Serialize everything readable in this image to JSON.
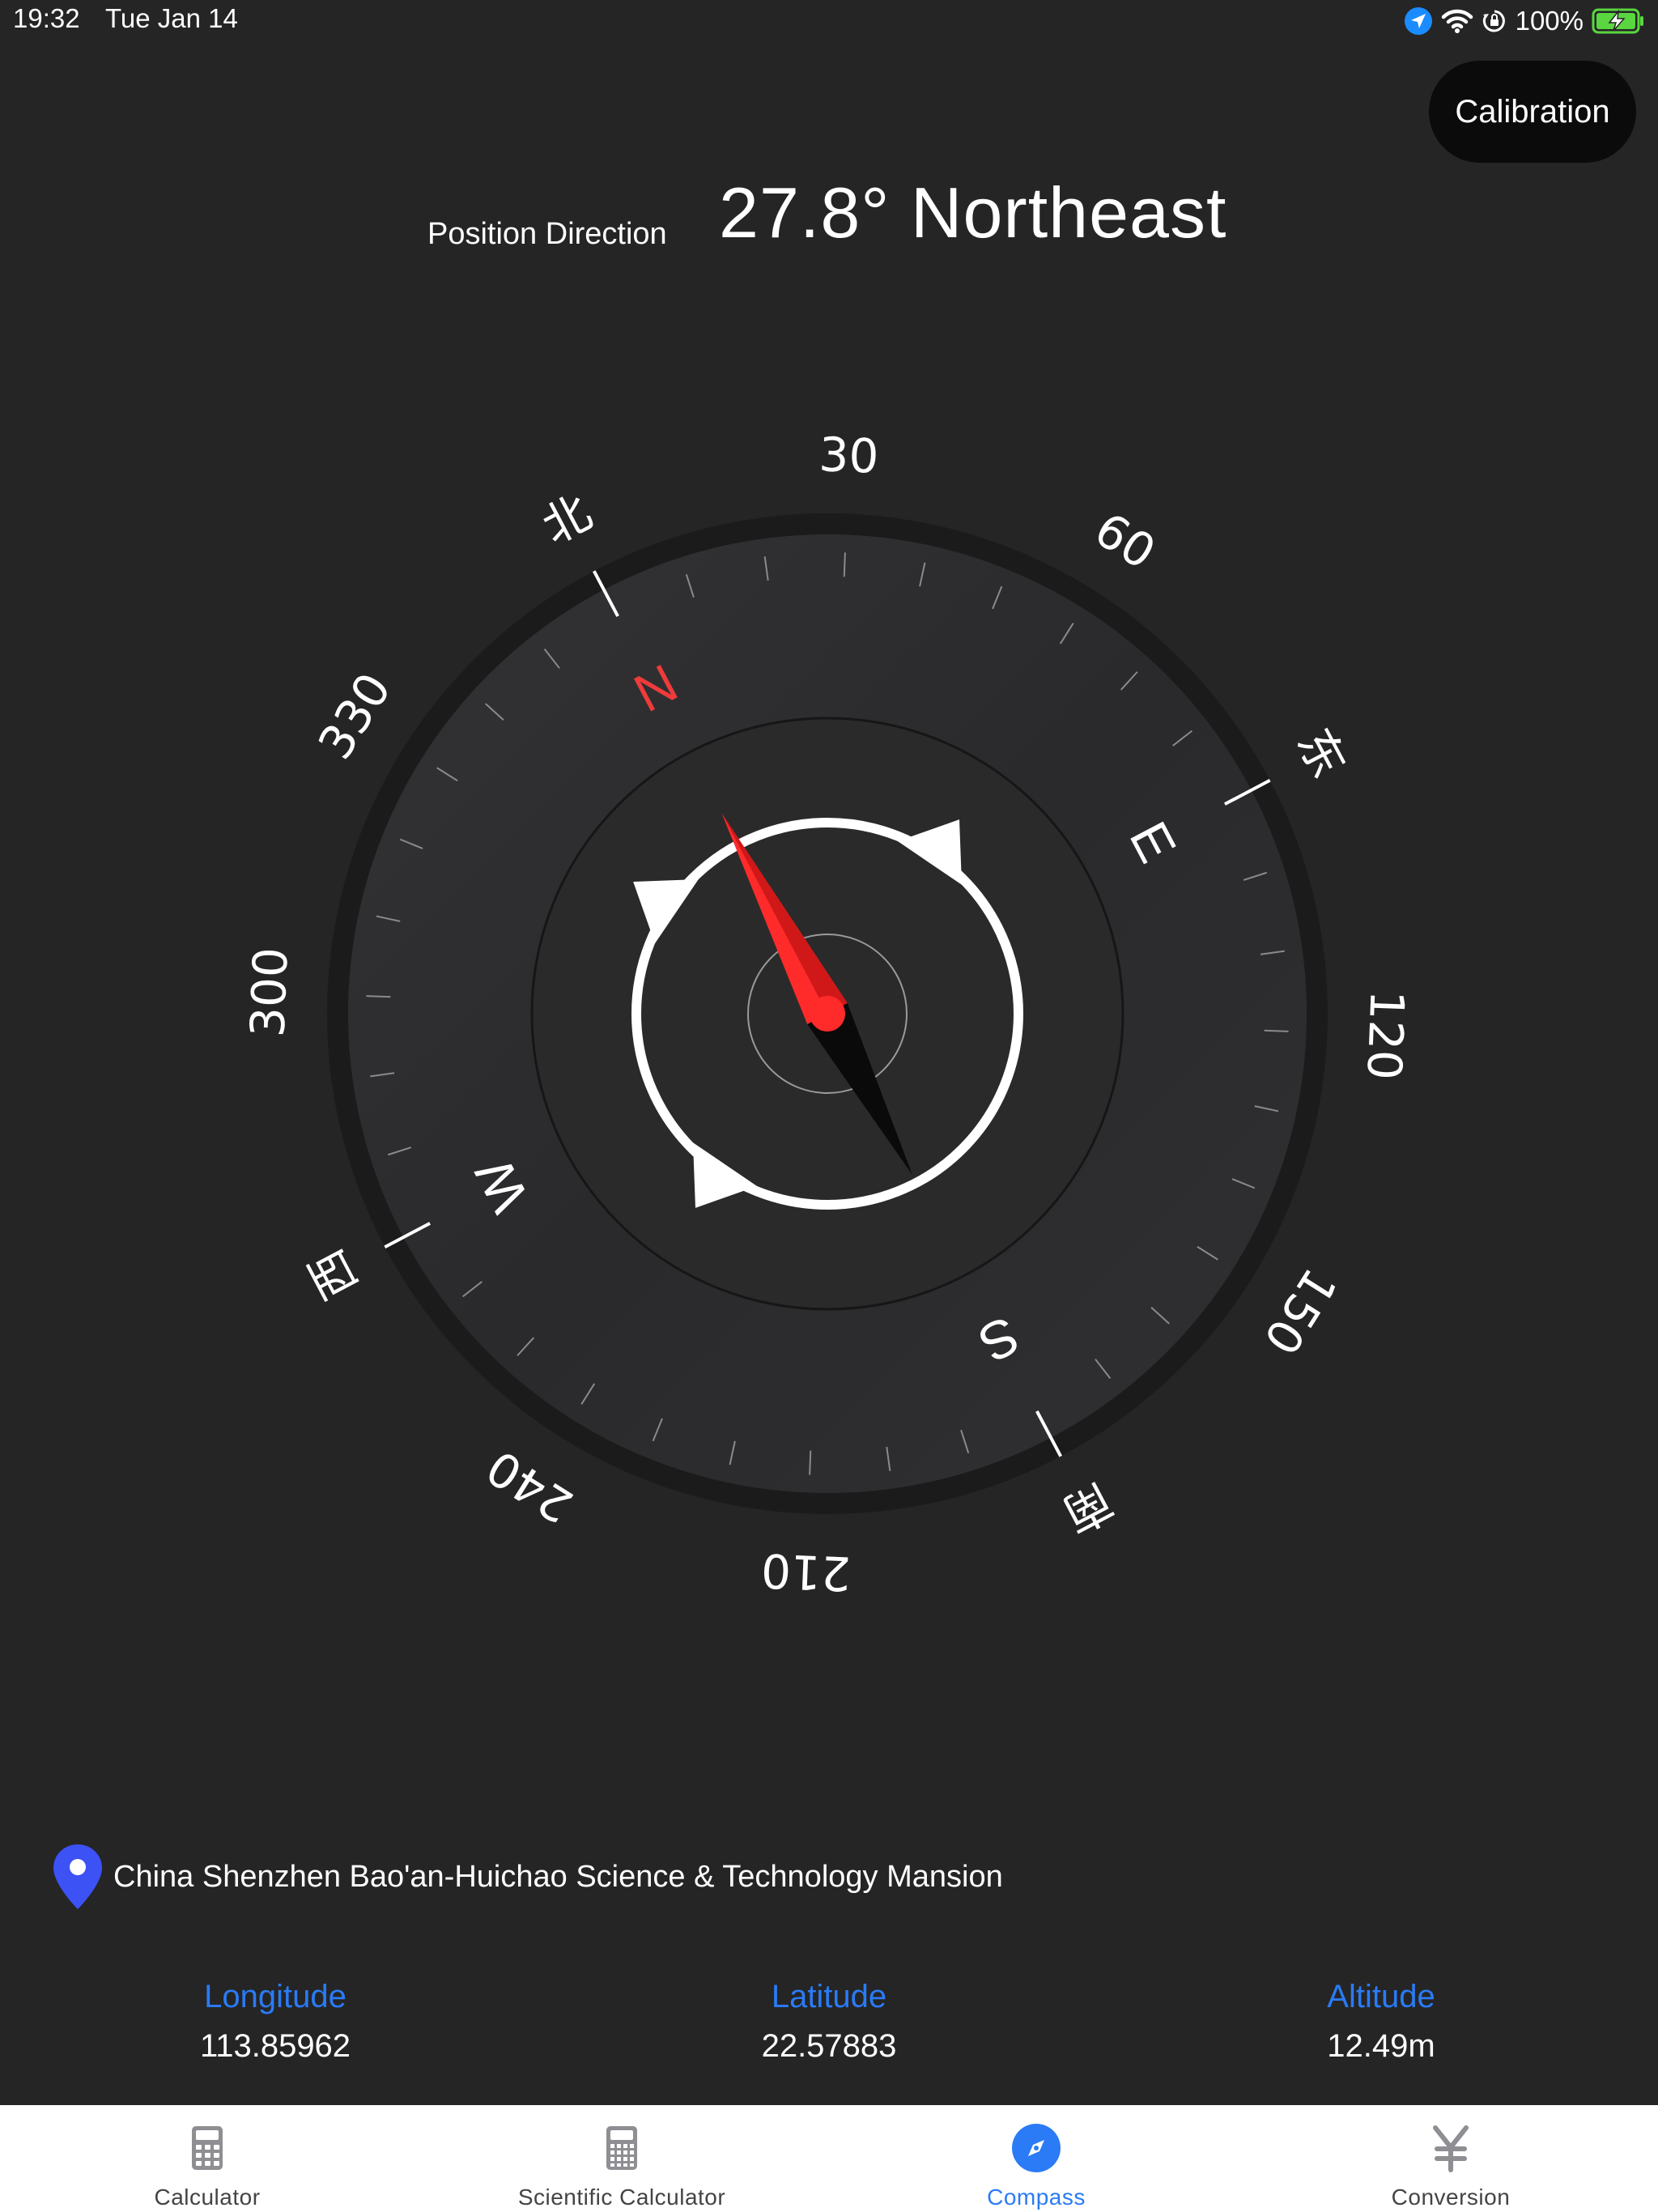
{
  "status_bar": {
    "time": "19:32",
    "date": "Tue Jan 14",
    "battery": "100%",
    "icons": [
      "location-arrow-icon",
      "wifi-icon",
      "orientation-lock-icon",
      "battery-charging-icon"
    ]
  },
  "calibration_label": "Calibration",
  "direction": {
    "label": "Position Direction",
    "value": "27.8° Northeast"
  },
  "compass": {
    "heading_degrees": 27.8,
    "needle_colors": {
      "north": "#ff2b2b",
      "south": "#0a0a0a"
    },
    "degree_labels": [
      "30",
      "60",
      "120",
      "150",
      "210",
      "240",
      "300",
      "330"
    ],
    "cardinal_letters": {
      "N": "N",
      "E": "E",
      "S": "S",
      "W": "W"
    },
    "chinese_directions": {
      "north": "北",
      "east": "东",
      "south": "南",
      "west": "西"
    },
    "accent_color": "#ef3b3b"
  },
  "location": {
    "icon": "map-pin-icon",
    "text": "China Shenzhen Bao'an-Huichao Science & Technology Mansion"
  },
  "coordinates": {
    "longitude": {
      "label": "Longitude",
      "value": "113.85962"
    },
    "latitude": {
      "label": "Latitude",
      "value": "22.57883"
    },
    "altitude": {
      "label": "Altitude",
      "value": "12.49m"
    }
  },
  "tabs": [
    {
      "label": "Calculator",
      "icon": "calculator-icon",
      "active": false
    },
    {
      "label": "Scientific Calculator",
      "icon": "scientific-calculator-icon",
      "active": false
    },
    {
      "label": "Compass",
      "icon": "compass-icon",
      "active": true
    },
    {
      "label": "Conversion",
      "icon": "yen-currency-icon",
      "active": false
    }
  ],
  "colors": {
    "background": "#252526",
    "accent_blue": "#2a7bf5",
    "pin_blue": "#3d52f5"
  }
}
